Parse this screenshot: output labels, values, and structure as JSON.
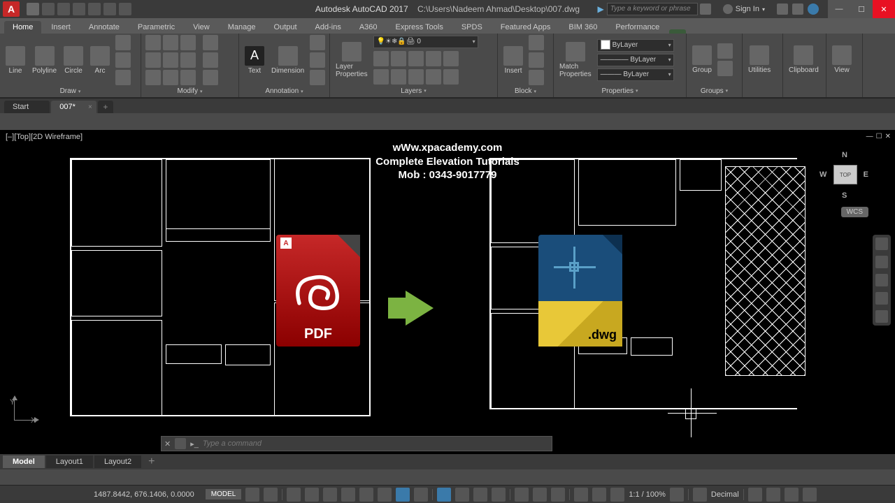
{
  "title": {
    "app": "Autodesk AutoCAD 2017",
    "doc": "C:\\Users\\Nadeem Ahmad\\Desktop\\007.dwg"
  },
  "search_placeholder": "Type a keyword or phrase",
  "signin": "Sign In",
  "menus": [
    "Home",
    "Insert",
    "Annotate",
    "Parametric",
    "View",
    "Manage",
    "Output",
    "Add-ins",
    "A360",
    "Express Tools",
    "SPDS",
    "Featured Apps",
    "BIM 360",
    "Performance"
  ],
  "ribbon": {
    "draw": {
      "title": "Draw",
      "items": [
        "Line",
        "Polyline",
        "Circle",
        "Arc"
      ]
    },
    "modify": {
      "title": "Modify"
    },
    "annotation": {
      "title": "Annotation",
      "text": "Text",
      "dim": "Dimension"
    },
    "layers": {
      "title": "Layers",
      "btn": "Layer\nProperties",
      "current": "0"
    },
    "block": {
      "title": "Block",
      "insert": "Insert"
    },
    "properties": {
      "title": "Properties",
      "match": "Match\nProperties",
      "color": "ByLayer",
      "lt": "ByLayer",
      "lw": "ByLayer"
    },
    "groups": {
      "title": "Groups",
      "btn": "Group"
    },
    "utilities": {
      "title": "Utilities"
    },
    "clipboard": {
      "title": "Clipboard"
    },
    "view": {
      "title": "View"
    }
  },
  "doctabs": {
    "start": "Start",
    "file": "007*"
  },
  "viewport_label": "[–][Top][2D Wireframe]",
  "overlay": {
    "line1": "wWw.xpacademy.com",
    "line2": "Complete Elevation Tutorials",
    "line3": "Mob : 0343-9017779"
  },
  "pdf_label": "PDF",
  "dwg_label": ".dwg",
  "viewcube": {
    "top": "TOP",
    "n": "N",
    "s": "S",
    "e": "E",
    "w": "W"
  },
  "wcs": "WCS",
  "ucs": {
    "x": "X",
    "y": "Y"
  },
  "cmdline": "Type a command",
  "layouts": {
    "model": "Model",
    "l1": "Layout1",
    "l2": "Layout2"
  },
  "status": {
    "coords": "1487.8442, 676.1406, 0.0000",
    "model": "MODEL",
    "scale": "1:1 / 100%",
    "units": "Decimal"
  }
}
